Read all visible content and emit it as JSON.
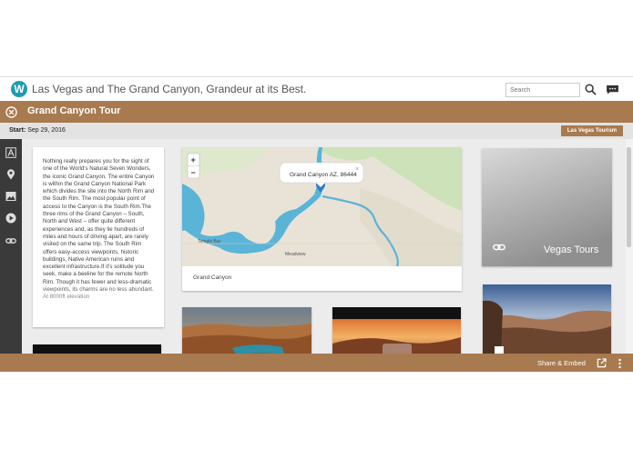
{
  "header": {
    "logo_letter": "W",
    "title": "Las Vegas and The Grand Canyon, Grandeur at its Best.",
    "search_placeholder": "Search"
  },
  "tour": {
    "title": "Grand Canyon Tour",
    "start_label": "Start:",
    "start_date": "Sep 29, 2016",
    "tag": "Las Vegas Tourism"
  },
  "story": {
    "text": "Nothing really prepares you for the sight of one of the World's Natural Seven Wonders, the iconic Grand Canyon. The entire Canyon is within the Grand Canyon National Park which divides the site into the North Rim and the South Rim. The most popular point of access to the Canyon is the South Rim.The three rims of the Grand Canyon – South, North and West – offer quite different experiences and, as they lie hundreds of miles and hours of driving apart, are rarely visited on the same trip. The South Rim offers easy-access viewpoints, historic buildings, Native American ruins and excellent infrastructure.If it's solitude you seek, make a beeline for the remote North Rim. Though it has fewer and less-dramatic viewpoints, its charms are no less abundant. At 8000ft elevation"
  },
  "map": {
    "popup": "Grand Canyon AZ, 86444",
    "popup_close": "×",
    "zoom_in": "+",
    "zoom_out": "−",
    "label_temple_bar": "Temple Bar",
    "label_meadview": "Meadview",
    "caption": "Grand Canyon"
  },
  "link_card": {
    "title": "Vegas Tours"
  },
  "footer": {
    "share_label": "Share & Embed"
  },
  "colors": {
    "brand_brown": "#a87a4f",
    "logo_teal": "#1f9bb3",
    "map_water": "#5ab4d8",
    "rail_dark": "#3a3a3a"
  },
  "icons": [
    "logo-icon",
    "search-icon",
    "chat-icon",
    "close-icon",
    "text-icon",
    "location-icon",
    "image-icon",
    "video-icon",
    "link-icon",
    "share-icon",
    "more-icon"
  ]
}
